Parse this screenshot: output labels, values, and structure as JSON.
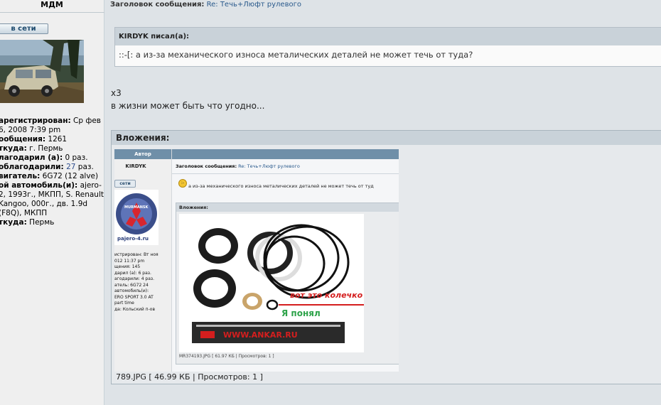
{
  "author": {
    "name": "МДМ",
    "online_label": "в сети"
  },
  "profile": {
    "registered_label": "арегистрирован:",
    "registered_value": "Ср фев 6, 2008 7:39 pm",
    "posts_label": "ообщения:",
    "posts_value": "1261",
    "from_label": "ткуда:",
    "from_value": "г. Пермь",
    "thanked_label": "лагодарил (а):",
    "thanked_value": "0 раз.",
    "thanks_got_label": "облагодарили:",
    "thanks_got_value": "27",
    "thanks_got_suffix": "раз.",
    "engine_label": "вигатель:",
    "engine_value": "6G72 (12 alve)",
    "car_label": "ой автомобиль(и):",
    "car_value": "ajero-2, 1993г., МКПП, S. Renault Kangoo, 000г., дв. 1.9d (F8Q), МКПП",
    "from2_label": "ткуда:",
    "from2_value": "Пермь"
  },
  "post": {
    "subject_label": "Заголовок сообщения:",
    "subject_link": "Re: Течь+Люфт рулевого",
    "quote_head": "KIRDYK писал(а):",
    "quote_text": "::-[: а из-за механического износа металических деталей не может течь от туда?",
    "line1": "х3",
    "line2": "в жизни может быть что угодно...",
    "attachments_head": "Вложения:",
    "attachment_footer": "789.JPG [ 46.99 КБ | Просмотров: 1 ]"
  },
  "thumbnail": {
    "author_head": "Автор",
    "name": "KIRDYK",
    "online_label": "сети",
    "subject_label": "Заголовок сообщения:",
    "subject_link": "Re: Течь+Люфт рулевого",
    "message": "а из-за механического износа металических деталей не может течь от туд",
    "attachments_head": "Вложения:",
    "footer": "MR374193.JPG [ 61.97 КБ | Просмотров: 1 ]",
    "logo_text_top": "MURMANSK",
    "logo_text_bottom": "pajero-4.ru",
    "photo_label1": "вот это колечко",
    "photo_label2": "Я понял",
    "ruler_text": "WWW.ANKAR.RU",
    "profile_lines": [
      "истрирован: Вт ноя",
      "012 11:37 pm",
      "щения: 145",
      "дарил (а): 6 раз.",
      "агодарили: 4 раз.",
      "атель: 6G72 24",
      "автомобиль(и):",
      "ERO SPORT 3.0 AT",
      "part time",
      "да: Кольский п-ов"
    ]
  },
  "colors": {
    "background": "#DEE3E7",
    "header_band": "#C9D2D9",
    "link": "#2A5A8C",
    "photo_red": "#D41E1E",
    "photo_green": "#2EA34A"
  }
}
